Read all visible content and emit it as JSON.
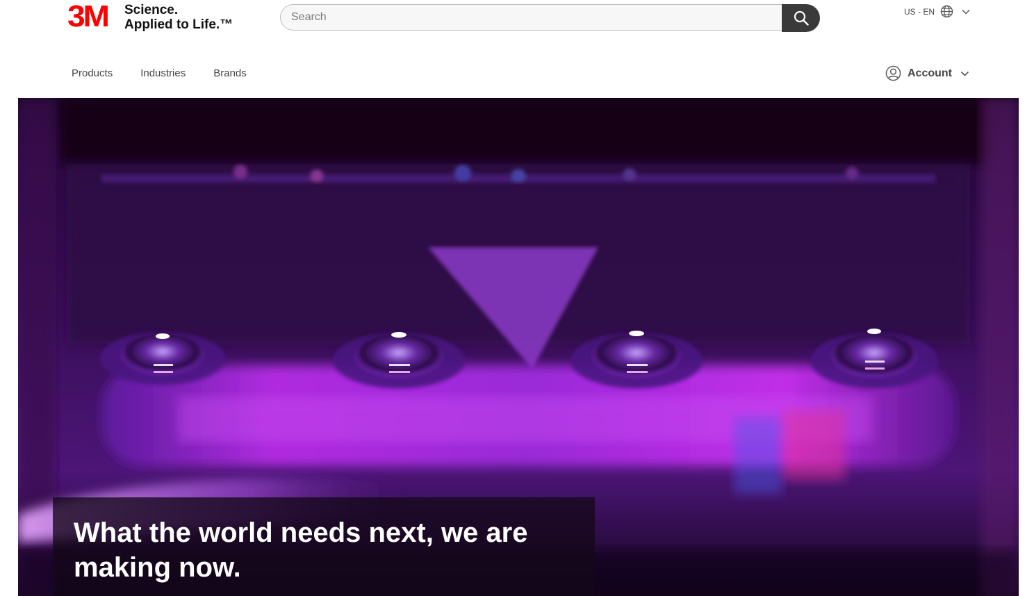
{
  "brand": {
    "logo_text": "3M",
    "tagline_line1": "Science.",
    "tagline_line2": "Applied to Life.™",
    "color": "#ff0000"
  },
  "search": {
    "placeholder": "Search",
    "button_icon": "search-icon"
  },
  "locale": {
    "label": "US - EN",
    "icon": "globe-icon"
  },
  "nav": {
    "items": [
      "Products",
      "Industries",
      "Brands"
    ]
  },
  "account": {
    "label": "Account",
    "icon": "user-circle-icon"
  },
  "hero": {
    "headline": "What the world needs next, we are making now.",
    "colors": {
      "primary": "#7a12b8",
      "accent": "#e02bd6",
      "dark": "#12051c"
    }
  }
}
